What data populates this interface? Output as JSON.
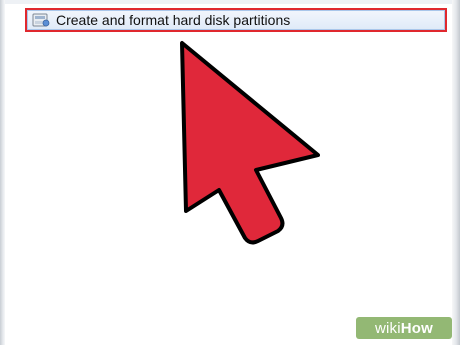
{
  "search_results": {
    "item": {
      "label": "Create and format hard disk partitions",
      "icon": "disk-management-icon"
    }
  },
  "overlay": {
    "pointer_icon": "cursor-arrow-icon",
    "pointer_color": "#e0283a"
  },
  "watermark": {
    "wiki": "wiki",
    "how": "How",
    "color": "#93b874"
  }
}
